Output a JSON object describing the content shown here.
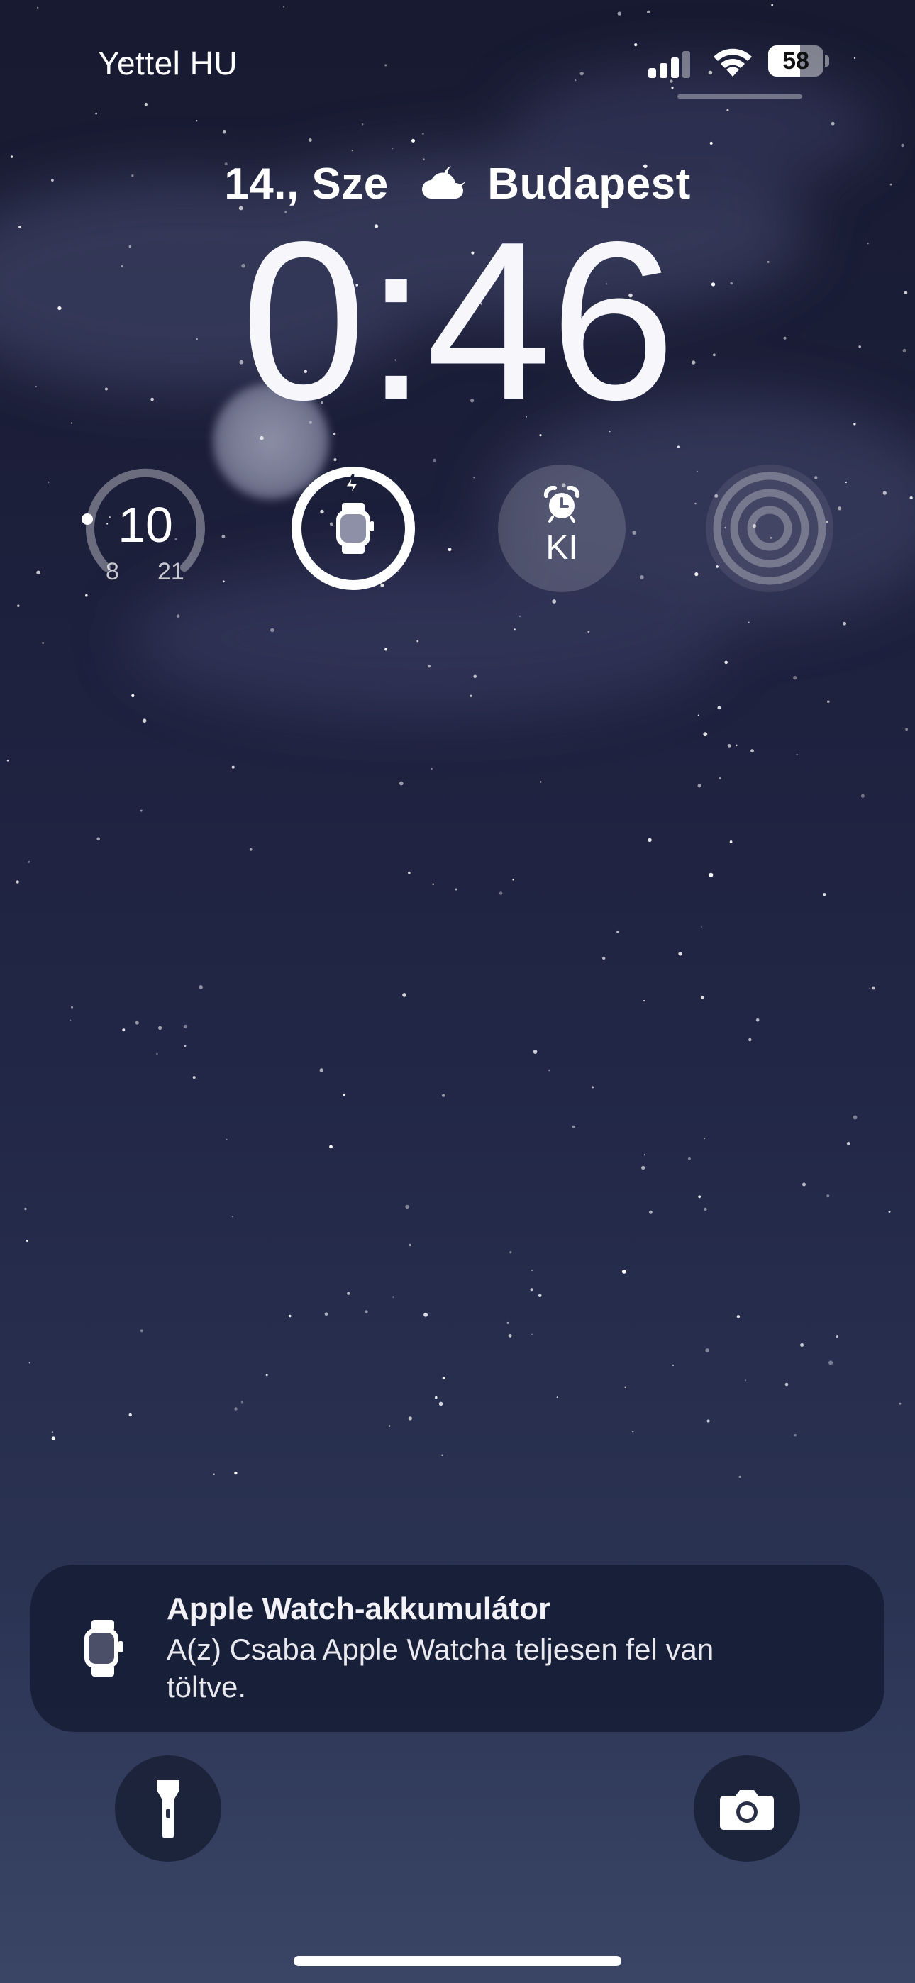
{
  "status_bar": {
    "carrier": "Yettel HU",
    "battery_percent": "58",
    "battery_level": 0.58,
    "signal_bars_active": 3,
    "signal_icon": "cellular-signal-icon",
    "wifi_icon": "wifi-icon"
  },
  "lock_screen": {
    "date": "14., Sze",
    "weather_icon": "partly-cloudy-night-icon",
    "city": "Budapest",
    "time": "0:46"
  },
  "widgets": {
    "temperature": {
      "current": "10",
      "low": "8",
      "high": "21"
    },
    "watch_battery": {
      "icon": "apple-watch-charging-icon",
      "level": 1.0
    },
    "alarm": {
      "icon": "alarm-clock-icon",
      "label": "KI"
    },
    "focus": {
      "icon": "concentric-rings-icon"
    }
  },
  "notification": {
    "icon": "apple-watch-icon",
    "title": "Apple Watch-akkumulátor",
    "body": "A(z) Csaba Apple Watcha teljesen fel van töltve."
  },
  "quick_actions": {
    "flashlight_icon": "flashlight-icon",
    "camera_icon": "camera-icon"
  },
  "colors": {
    "background_top": "#171a30",
    "background_bottom": "#3a4566",
    "notification_bg": "#161c34"
  }
}
